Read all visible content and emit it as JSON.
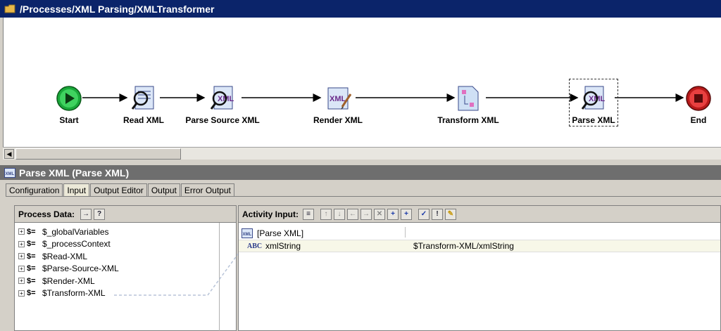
{
  "process": {
    "path": "/Processes/XML Parsing/XMLTransformer",
    "nodes": [
      {
        "label": "Start",
        "icon": "start-icon"
      },
      {
        "label": "Read XML",
        "icon": "read-xml-icon"
      },
      {
        "label": "Parse Source XML",
        "icon": "parse-xml-icon"
      },
      {
        "label": "Render XML",
        "icon": "render-xml-icon"
      },
      {
        "label": "Transform XML",
        "icon": "transform-xml-icon"
      },
      {
        "label": "Parse XML",
        "icon": "parse-xml-icon"
      },
      {
        "label": "End",
        "icon": "end-icon"
      }
    ]
  },
  "panel": {
    "title": "Parse XML (Parse XML)",
    "tabs": [
      "Configuration",
      "Input",
      "Output Editor",
      "Output",
      "Error Output"
    ],
    "active_tab": "Input"
  },
  "process_data": {
    "label": "Process Data:",
    "items": [
      "$_globalVariables",
      "$_processContext",
      "$Read-XML",
      "$Parse-Source-XML",
      "$Render-XML",
      "$Transform-XML"
    ]
  },
  "activity_input": {
    "label": "Activity Input:",
    "root": "[Parse XML]",
    "field_name": "xmlString",
    "field_value": "$Transform-XML/xmlString"
  },
  "colors": {
    "title_bar": "#0b246a",
    "panel_title": "#6e6e6e",
    "start_green": "#1aa83a",
    "end_red": "#d42a2a"
  }
}
